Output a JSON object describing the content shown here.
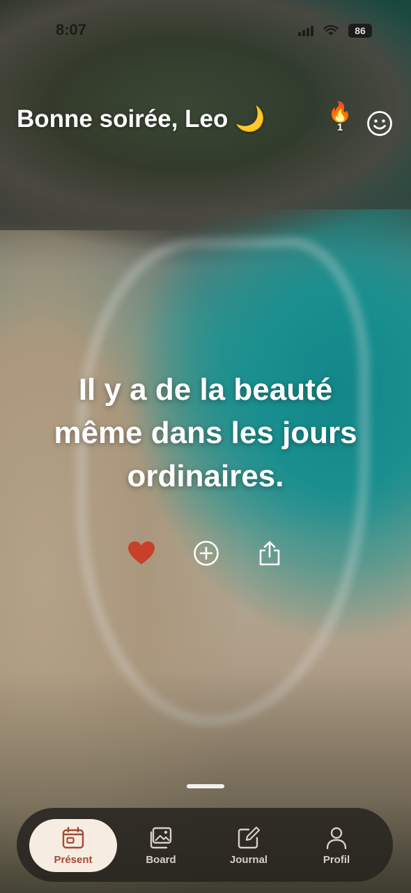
{
  "status_bar": {
    "time": "8:07",
    "battery": "86",
    "icons": [
      "signal-icon",
      "wifi-icon",
      "battery-icon"
    ]
  },
  "header": {
    "greeting": "Bonne soirée, Leo 🌙",
    "streak_icon": "🔥",
    "streak_count": "1",
    "mood_icon": "smiley-icon"
  },
  "quote": {
    "line1": "Il y a de la beauté",
    "line2": "même dans les jours",
    "line3": "ordinaires."
  },
  "actions": {
    "like_icon": "heart-icon",
    "add_icon": "plus-circle-icon",
    "share_icon": "share-icon",
    "like_color": "#c8402a"
  },
  "tabbar": {
    "tabs": [
      {
        "label": "Présent",
        "icon": "calendar-icon",
        "active": true
      },
      {
        "label": "Board",
        "icon": "gallery-icon",
        "active": false
      },
      {
        "label": "Journal",
        "icon": "edit-icon",
        "active": false
      },
      {
        "label": "Profil",
        "icon": "user-icon",
        "active": false
      }
    ],
    "active_bg": "#f6ece2",
    "active_color": "#a24a34"
  }
}
